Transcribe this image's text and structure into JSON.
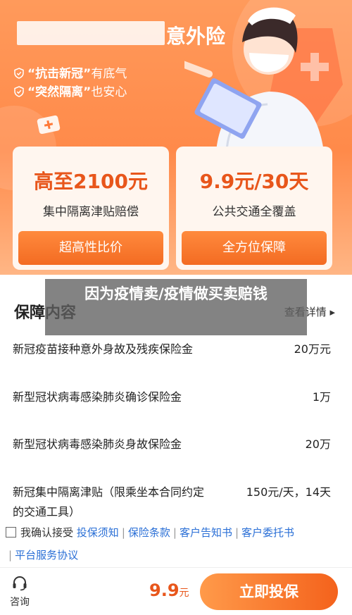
{
  "header": {
    "title_suffix": "意外险",
    "slogans": [
      {
        "highlight": "“抗击新冠”",
        "rest": "有底气"
      },
      {
        "highlight": "“突然隔离”",
        "rest": "也安心"
      }
    ]
  },
  "cards": [
    {
      "amount": "高至2100元",
      "desc": "集中隔离津贴赔偿",
      "button": "超高性比价"
    },
    {
      "amount": "9.9元/30天",
      "desc": "公共交通全覆盖",
      "button": "全方位保障"
    }
  ],
  "coverage": {
    "title": "保障内容",
    "detail_link": "查看详情 ▸",
    "rows": [
      {
        "label": "新冠疫苗接种意外身故及残疾保险金",
        "value": "20万元"
      },
      {
        "label": "新型冠状病毒感染肺炎确诊保险金",
        "value": "1万"
      },
      {
        "label": "新型冠状病毒感染肺炎身故保险金",
        "value": "20万"
      },
      {
        "label": "新冠集中隔离津贴（限乘坐本合同约定的交通工具）",
        "value": "150元/天，14天"
      }
    ]
  },
  "agreement": {
    "prefix": "我确认接受",
    "links": [
      "投保须知",
      "保险条款",
      "客户告知书",
      "客户委托书",
      "平台服务协议"
    ],
    "separator": "|"
  },
  "bottom": {
    "consult_label": "咨询",
    "price": "9.9",
    "price_unit": "元",
    "buy_label": "立即投保"
  },
  "overlay": {
    "text": "因为疫情卖/疫情做买卖赔钱"
  },
  "colors": {
    "accent": "#f36b22",
    "price": "#e8561b",
    "link": "#2a6fd6"
  }
}
